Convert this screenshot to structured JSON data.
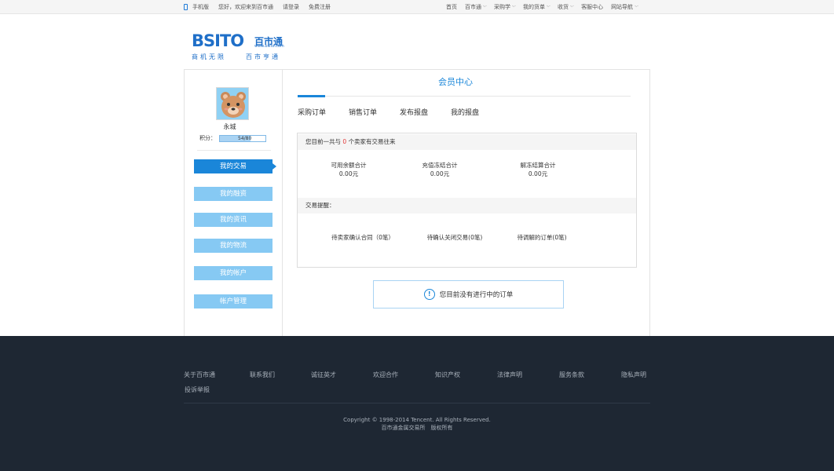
{
  "topbar": {
    "mobile": "手机版",
    "welcome": "您好，欢迎来到百市通",
    "login": "请登录",
    "register": "免费注册",
    "home": "首页",
    "bsito": "百市通",
    "purchase": "采购学",
    "my_list": "我的货单",
    "favorites": "收货",
    "service": "客服中心",
    "site_nav": "网站导航"
  },
  "logo": {
    "brand": "BSITO",
    "cn": "百市通",
    "url": "www.bsito.com",
    "slogan_left": "商机无限",
    "slogan_right": "百市亨通"
  },
  "sidebar": {
    "username": "永城",
    "points_label": "积分：",
    "points_value": "54/80",
    "points_fraction": 0.675,
    "items": [
      {
        "label": "我的交易",
        "active": true
      },
      {
        "label": "我的融资"
      },
      {
        "label": "我的资讯"
      },
      {
        "label": "我的物流"
      },
      {
        "label": "我的帐户"
      },
      {
        "label": "帐户管理"
      }
    ]
  },
  "main": {
    "title": "会员中心",
    "tabs": [
      "采购订单",
      "销售订单",
      "发布报盘",
      "我的报盘"
    ],
    "trade_head_pre": "您目前一共与",
    "trade_count": "0",
    "trade_head_post": "个卖家有交易往来",
    "stats": [
      {
        "label": "可用余额合计",
        "value": "0.00元"
      },
      {
        "label": "充值冻结合计",
        "value": "0.00元"
      },
      {
        "label": "解冻结算合计",
        "value": "0.00元"
      }
    ],
    "reminder_head": "交易提醒：",
    "reminders": [
      "待卖家确认合同（0笔）",
      "待确认关闭交易(0笔)",
      "待调解的订单(0笔)"
    ],
    "notice": "您目前没有进行中的订单"
  },
  "footer": {
    "links": [
      "关于百市通",
      "联系我们",
      "诚征英才",
      "欢迎合作",
      "知识产权",
      "法律声明",
      "服务条款",
      "隐私声明",
      "投诉举报"
    ],
    "copyright": "Copyright © 1998-2014 Tencent. All Rights Reserved.",
    "rights": "百市通金属交易所　版权所有"
  },
  "colors": {
    "accent": "#1a86d9",
    "menu_inactive": "#86c9f3",
    "footer_bg": "#1e2733",
    "highlight_red": "#e23c3c"
  }
}
